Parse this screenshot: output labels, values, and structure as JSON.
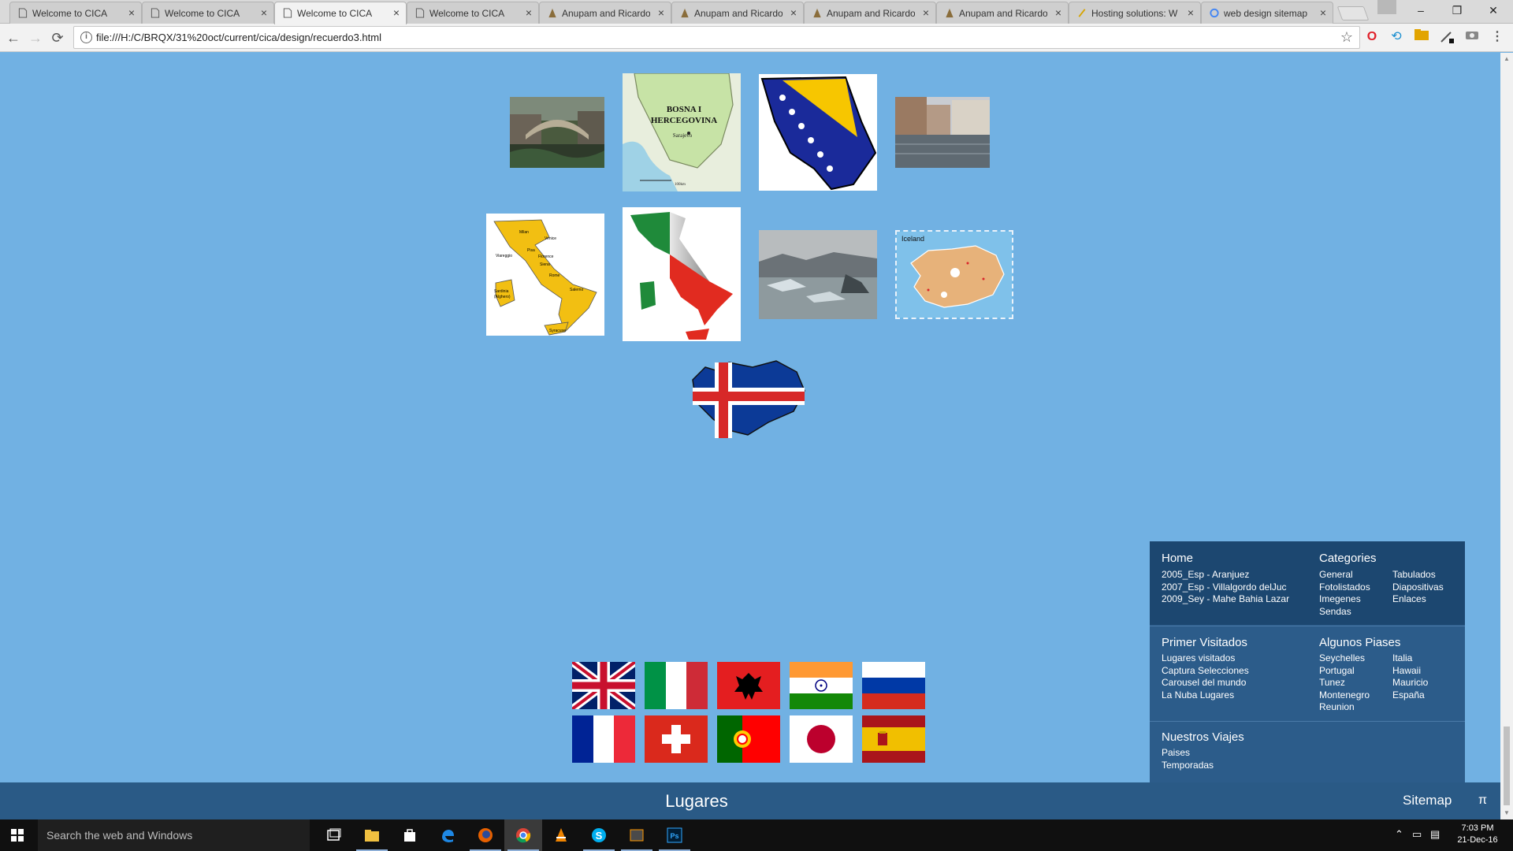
{
  "browser": {
    "tabs": [
      {
        "title": "Welcome to CICA",
        "active": false,
        "icon": "page-icon"
      },
      {
        "title": "Welcome to CICA",
        "active": false,
        "icon": "page-icon"
      },
      {
        "title": "Welcome to CICA",
        "active": true,
        "icon": "page-icon"
      },
      {
        "title": "Welcome to CICA",
        "active": false,
        "icon": "page-icon"
      },
      {
        "title": "Anupam and Ricardo",
        "active": false,
        "icon": "site-icon"
      },
      {
        "title": "Anupam and Ricardo",
        "active": false,
        "icon": "site-icon"
      },
      {
        "title": "Anupam and Ricardo",
        "active": false,
        "icon": "site-icon"
      },
      {
        "title": "Anupam and Ricardo",
        "active": false,
        "icon": "site-icon"
      },
      {
        "title": "Hosting solutions: W",
        "active": false,
        "icon": "hosting-icon"
      },
      {
        "title": "web design sitemap",
        "active": false,
        "icon": "google-icon"
      }
    ],
    "tab_close": "×",
    "window_controls": {
      "minimize": "–",
      "restore": "❐",
      "close": "✕"
    },
    "url": "file:///H:/C/BRQX/31%20oct/current/cica/design/recuerdo3.html",
    "back": "←",
    "forward": "→",
    "reload": "⟳",
    "star": "☆"
  },
  "photos": [
    {
      "name": "mostar-bridge-photo",
      "kind": "photo-bridge"
    },
    {
      "name": "bosnia-map-image",
      "kind": "map-bosnia",
      "labels": [
        "BOSNA I",
        "HERCEGOVINA",
        "Sarajevo",
        "100km"
      ]
    },
    {
      "name": "bosnia-flag-map-image",
      "kind": "bosnia-flag"
    },
    {
      "name": "venice-canal-photo",
      "kind": "photo-canal"
    },
    {
      "name": "italy-map-image",
      "kind": "map-italy",
      "labels": [
        "Milan",
        "Venice",
        "Viareggio",
        "Pisa",
        "Florence",
        "Siena",
        "Rome",
        "Salerno",
        "Sardinia",
        "(Alghero)",
        "Syracuse"
      ]
    },
    {
      "name": "italy-flag-map-image",
      "kind": "italy-flag"
    },
    {
      "name": "glacier-lagoon-photo",
      "kind": "photo-glacier"
    },
    {
      "name": "iceland-map-image",
      "kind": "map-iceland",
      "labels": [
        "Iceland"
      ]
    },
    {
      "name": "iceland-flag-map-image",
      "kind": "iceland-flag"
    }
  ],
  "flags": [
    {
      "name": "uk-flag",
      "country": "United Kingdom"
    },
    {
      "name": "italy-flag",
      "country": "Italia"
    },
    {
      "name": "albania-flag",
      "country": "Albania"
    },
    {
      "name": "india-flag",
      "country": "India"
    },
    {
      "name": "russia-flag",
      "country": "Russia"
    },
    {
      "name": "france-flag",
      "country": "France"
    },
    {
      "name": "switzerland-flag",
      "country": "Switzerland"
    },
    {
      "name": "portugal-flag",
      "country": "Portugal"
    },
    {
      "name": "japan-flag",
      "country": "Japan"
    },
    {
      "name": "spain-flag",
      "country": "España"
    }
  ],
  "sitemap": {
    "home": {
      "heading": "Home",
      "links": [
        "2005_Esp - Aranjuez",
        "2007_Esp - Villalgordo delJuc",
        "2009_Sey - Mahe Bahia Lazar"
      ]
    },
    "categories": {
      "heading": "Categories",
      "col1": [
        "General",
        "Fotolistados",
        "Imegenes",
        "Sendas"
      ],
      "col2": [
        "Tabulados",
        "Diapositivas",
        "Enlaces"
      ]
    },
    "primer": {
      "heading": "Primer Visitados",
      "links": [
        "Lugares visitados",
        "Captura Selecciones",
        "Carousel del mundo",
        "La Nuba Lugares"
      ]
    },
    "algunos": {
      "heading": "Algunos Piases",
      "col1": [
        "Seychelles",
        "Portugal",
        "Tunez",
        "Montenegro",
        "Reunion"
      ],
      "col2": [
        "Italia",
        "Hawaii",
        "Mauricio",
        "España"
      ]
    },
    "viajes": {
      "heading": "Nuestros Viajes",
      "links": [
        "Paises",
        "Temporadas"
      ]
    }
  },
  "footer": {
    "title": "Lugares",
    "sitemap_link": "Sitemap",
    "pi": "π"
  },
  "taskbar": {
    "search_placeholder": "Search the web and Windows",
    "apps": [
      "task-view",
      "file-explorer",
      "store",
      "edge",
      "firefox",
      "chrome",
      "vlc",
      "skype",
      "sublime",
      "photoshop"
    ],
    "active_app": "chrome",
    "time": "7:03 PM",
    "date": "21-Dec-16"
  },
  "colors": {
    "page_bg": "#71b1e3",
    "footer_bg": "#2a5a86",
    "sitemap_dark": "#1c4770",
    "sitemap_mid": "#2c5c8a"
  }
}
